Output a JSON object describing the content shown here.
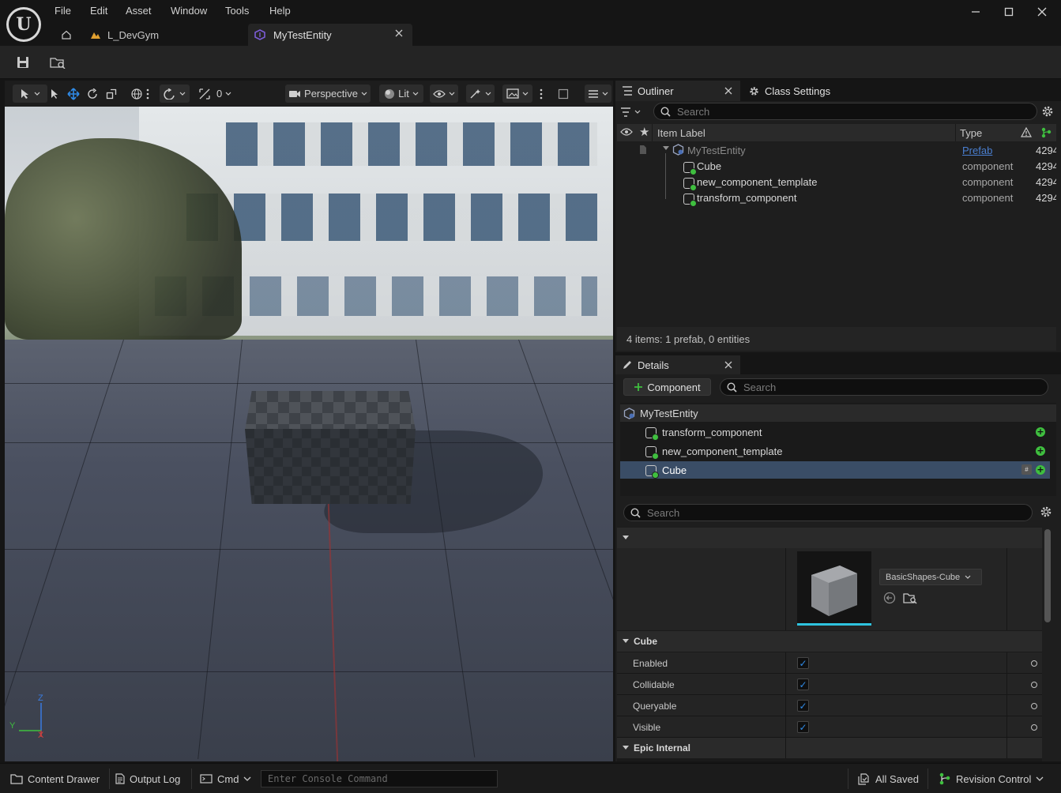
{
  "menu": [
    "File",
    "Edit",
    "Asset",
    "Window",
    "Tools",
    "Help"
  ],
  "tabs": [
    {
      "label": "L_DevGym"
    },
    {
      "label": "MyTestEntity"
    }
  ],
  "viewport": {
    "snap_value": "0",
    "perspective_label": "Perspective",
    "lit_label": "Lit",
    "axis_z": "Z",
    "axis_y": "Y",
    "axis_x": "X"
  },
  "outliner": {
    "tab_label": "Outliner",
    "class_settings_label": "Class Settings",
    "search_placeholder": "Search",
    "col_label": "Item Label",
    "col_type": "Type",
    "rows": [
      {
        "label": "MyTestEntity",
        "type": "Prefab",
        "id": "4294"
      },
      {
        "label": "Cube",
        "type": "component",
        "id": "4294"
      },
      {
        "label": "new_component_template",
        "type": "component",
        "id": "4294"
      },
      {
        "label": "transform_component",
        "type": "component",
        "id": "4294"
      }
    ],
    "summary": "4 items: 1 prefab, 0 entities"
  },
  "details": {
    "tab_label": "Details",
    "add_component_label": "Component",
    "search_placeholder": "Search",
    "root": "MyTestEntity",
    "components": [
      "transform_component",
      "new_component_template",
      "Cube"
    ],
    "selected_component": "Cube",
    "props_search_placeholder": "Search",
    "mesh_asset": "BasicShapes-Cube",
    "section_cube": "Cube",
    "properties": [
      {
        "label": "Enabled",
        "checked": true
      },
      {
        "label": "Collidable",
        "checked": true
      },
      {
        "label": "Queryable",
        "checked": true
      },
      {
        "label": "Visible",
        "checked": true
      }
    ],
    "section_epic": "Epic Internal"
  },
  "statusbar": {
    "content_drawer": "Content Drawer",
    "output_log": "Output Log",
    "cmd": "Cmd",
    "console_placeholder": "Enter Console Command",
    "all_saved": "All Saved",
    "revision_control": "Revision Control"
  },
  "colors": {
    "accent_blue": "#2f8ae6",
    "selected_row": "#3a4d66",
    "green_add": "#3fbf3f",
    "tab_icon_purple": "#7b5cd6",
    "level_icon_orange": "#e0a030"
  }
}
